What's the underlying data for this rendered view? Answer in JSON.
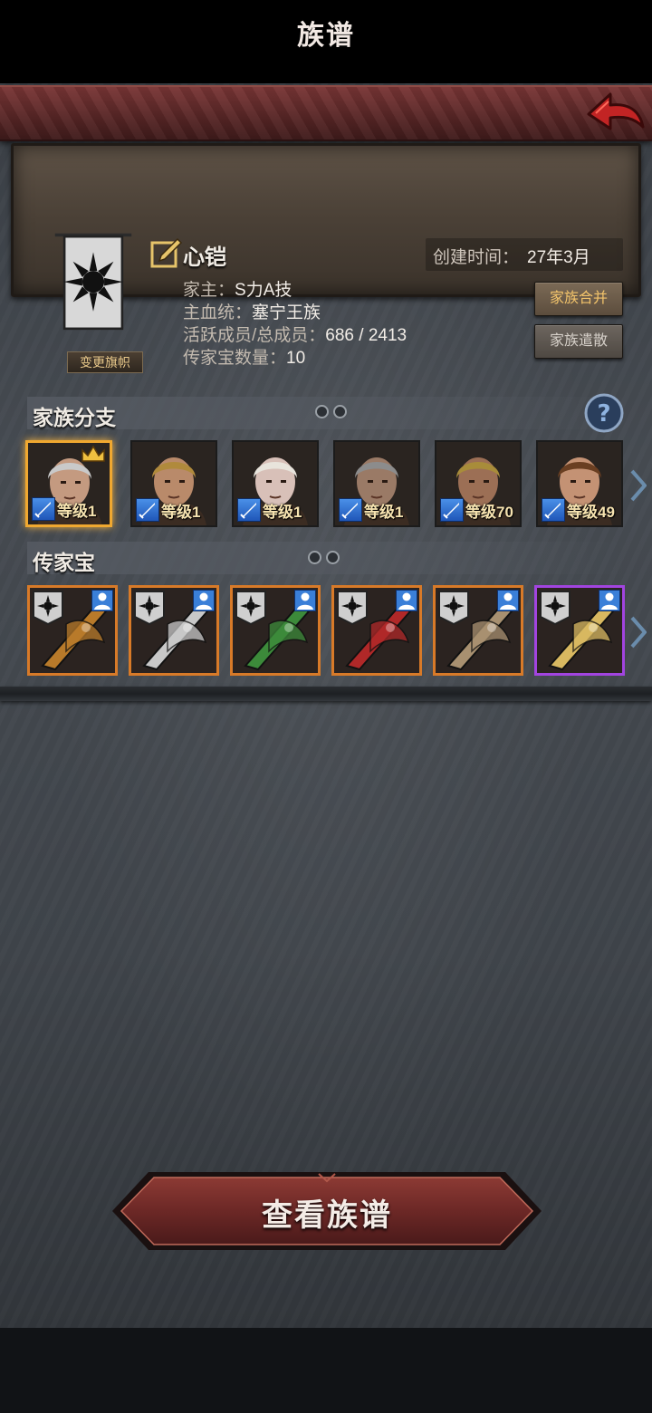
{
  "header": {
    "title": "族谱"
  },
  "family": {
    "change_banner_label": "变更旗帜",
    "name": "心铠",
    "created_label": "创建时间：",
    "created_value": "27年3月",
    "head_label": "家主：",
    "head_value": "S力A技",
    "bloodline_label": "主血统：",
    "bloodline_value": "塞宁王族",
    "members_label": "活跃成员/总成员：",
    "members_value": "686 / 2413",
    "heirloom_count_label": "传家宝数量：",
    "heirloom_count_value": "10",
    "merge_label": "家族合并",
    "disband_label": "家族遣散"
  },
  "branches": {
    "title": "家族分支",
    "members": [
      {
        "level_text": "等级1",
        "hair": "#c9c9c9",
        "skin": "#c49a80",
        "selected": true
      },
      {
        "level_text": "等级1",
        "hair": "#b08a3c",
        "skin": "#b98a6a",
        "selected": false
      },
      {
        "level_text": "等级1",
        "hair": "#e8e4dc",
        "skin": "#d8c0b8",
        "selected": false
      },
      {
        "level_text": "等级1",
        "hair": "#8c8c8c",
        "skin": "#9a7a66",
        "selected": false
      },
      {
        "level_text": "等级70",
        "hair": "#a88c3a",
        "skin": "#9c6f55",
        "selected": false
      },
      {
        "level_text": "等级49",
        "hair": "#6a3f22",
        "skin": "#c49274",
        "selected": false
      }
    ]
  },
  "heirlooms": {
    "title": "传家宝",
    "items": [
      {
        "name": "golden-blade-icon",
        "color": "#b87a2a",
        "rarity": "orange"
      },
      {
        "name": "silver-halberd-icon",
        "color": "#c8c8c8",
        "rarity": "orange"
      },
      {
        "name": "green-armor-icon",
        "color": "#3c8a3a",
        "rarity": "orange"
      },
      {
        "name": "red-sword-icon",
        "color": "#b02828",
        "rarity": "orange"
      },
      {
        "name": "fur-armor-icon",
        "color": "#a89070",
        "rarity": "orange"
      },
      {
        "name": "golden-cape-icon",
        "color": "#d8b860",
        "rarity": "purple"
      }
    ]
  },
  "footer": {
    "view_button_label": "查看族谱"
  },
  "colors": {
    "accent_red": "#7a3636",
    "gold": "#f3c46b",
    "orange_rarity": "#d87a28",
    "purple_rarity": "#a244e0"
  }
}
